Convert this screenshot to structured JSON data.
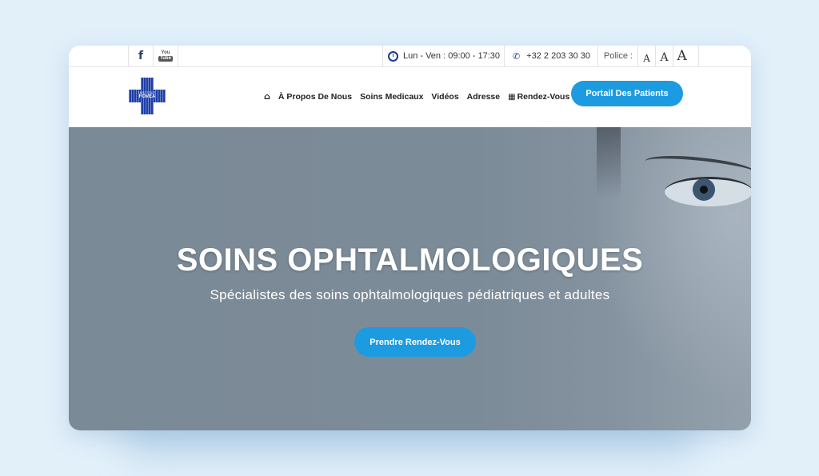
{
  "topbar": {
    "facebook_icon": "f",
    "youtube_you": "You",
    "youtube_tube": "Tube",
    "hours": "Lun - Ven : 09:00 - 17:30",
    "phone": "+32 2 203 30 30",
    "police_label": "Police :",
    "font_sizes": [
      "A",
      "A",
      "A"
    ]
  },
  "logo": {
    "line1": "INSTITUT",
    "line2": "FOVEA"
  },
  "nav": {
    "home_icon": "⌂",
    "items": [
      "À Propos De Nous",
      "Soins Medicaux",
      "Vidéos",
      "Adresse"
    ],
    "rdv_icon": "▦",
    "rdv_label": "Rendez-Vous"
  },
  "portal_button": "Portail Des Patients",
  "hero": {
    "title": "SOINS OPHTALMOLOGIQUES",
    "subtitle": "Spécialistes des soins ophtalmologiques pédiatriques et adultes",
    "cta": "Prendre Rendez-Vous"
  },
  "colors": {
    "accent": "#1d9be0",
    "brand": "#1e3fa8",
    "hero_bg": "#7b8a97"
  }
}
